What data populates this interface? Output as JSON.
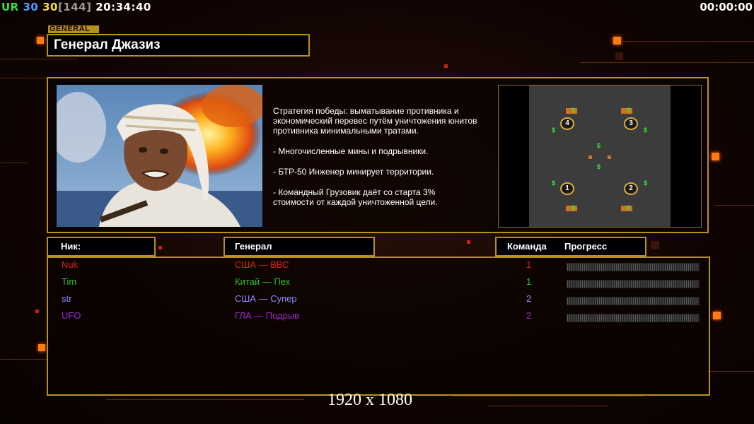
{
  "status_bar": {
    "rank": "UR",
    "value_a": "30",
    "value_b": "30",
    "bracket": "[144]",
    "clock": "20:34:40",
    "timer": "00:00:00"
  },
  "general": {
    "tag": "GENERAL",
    "name": "Генерал Джазиз",
    "description": [
      "Стратегия победы: выматывание противника и\n экономический перевес путём уничтожения юнитов\n противника минимальными тратами.",
      "- Многочисленные мины и подрывники.",
      "- БТР-50 Инженер минирует территории.",
      "- Командный Грузовик даёт со старта 3%\n стоимости от каждой уничтоженной цели."
    ]
  },
  "minimap": {
    "start_positions": [
      "4",
      "3",
      "1",
      "2"
    ],
    "cash_icon": "$"
  },
  "table": {
    "headers": {
      "nick": "Ник:",
      "general": "Генерал",
      "team": "Команда",
      "progress": "Прогресс"
    },
    "players": [
      {
        "nick": "Nuk",
        "general": "США — ВВС",
        "team": "1",
        "color": "#e0201c",
        "progress": 0
      },
      {
        "nick": "Tim",
        "general": "Китай — Пех",
        "team": "1",
        "color": "#2ec02e",
        "progress": 0
      },
      {
        "nick": "str",
        "general": "США — Супер",
        "team": "2",
        "color": "#8c8cff",
        "progress": 0
      },
      {
        "nick": "UFO",
        "general": "ГЛА — Подрыв",
        "team": "2",
        "color": "#9a2ad0",
        "progress": 0
      }
    ]
  },
  "resolution_overlay": "1920 x 1080",
  "colors": {
    "accent_gold": "#b8901c",
    "rank_green": "#3ae03a",
    "value_a": "#4aa0ff",
    "value_b": "#f0e040",
    "bracket": "#9a9a9a"
  }
}
